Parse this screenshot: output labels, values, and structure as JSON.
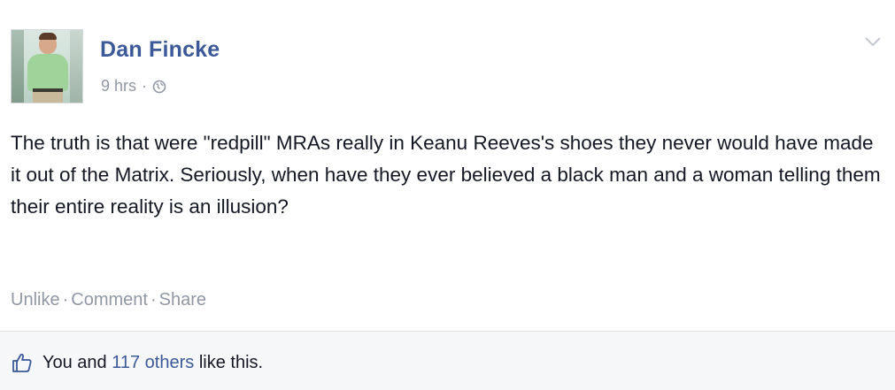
{
  "post": {
    "author": "Dan Fincke",
    "timestamp": "9 hrs",
    "separator": "·",
    "privacy_icon": "globe-icon",
    "text": "The truth is that were \"redpill\" MRAs really in Keanu Reeves's shoes they never would have made it out of the Matrix. Seriously, when have they ever believed a black man and a woman telling them their entire reality is an illusion?",
    "menu_icon": "chevron-down-icon"
  },
  "actions": {
    "unlike": "Unlike",
    "comment": "Comment",
    "share": "Share",
    "separator": "·"
  },
  "likes": {
    "icon": "thumbs-up-icon",
    "prefix": "You and ",
    "count": "117 others",
    "suffix": " like this."
  },
  "colors": {
    "link_blue": "#3b5998",
    "meta_gray": "#9197a3",
    "text": "#141823",
    "likes_bg": "#f6f7f9"
  }
}
